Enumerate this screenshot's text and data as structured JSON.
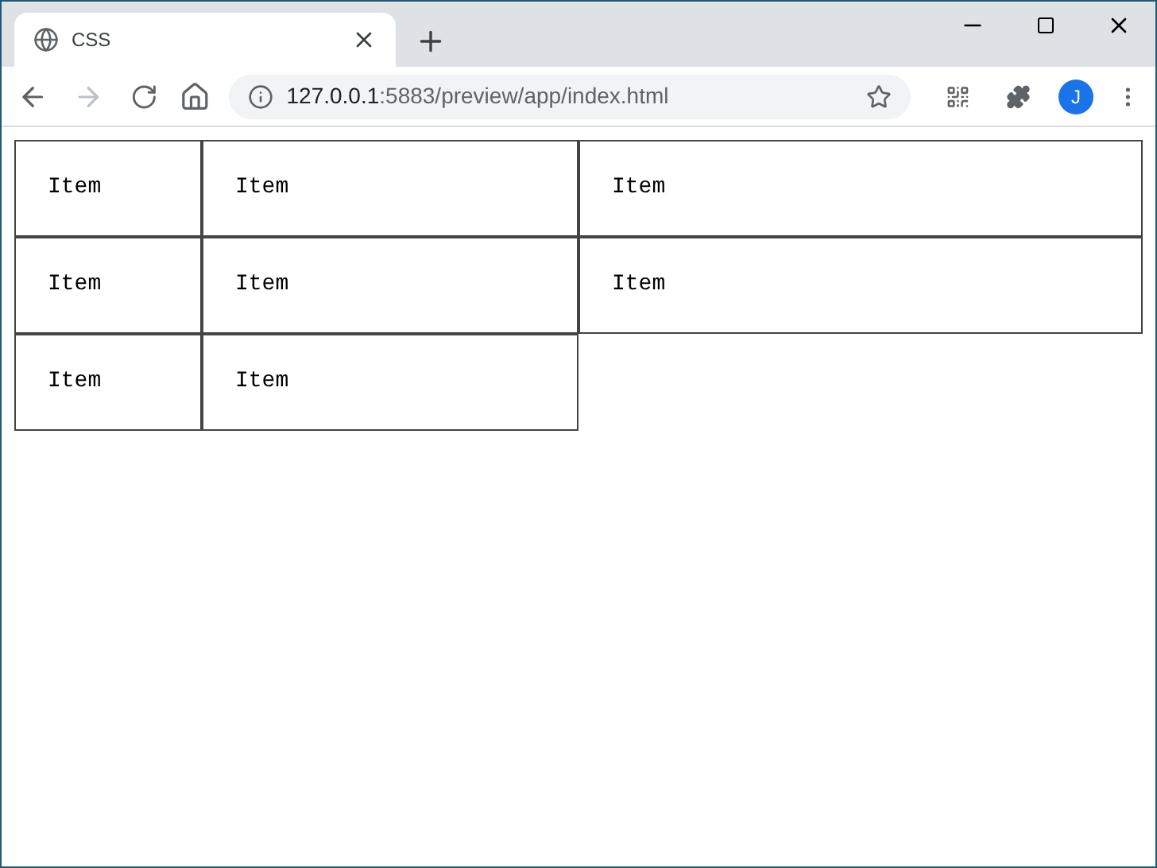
{
  "tab": {
    "title": "CSS"
  },
  "address_bar": {
    "host": "127.0.0.1",
    "path": ":5883/preview/app/index.html"
  },
  "profile": {
    "initial": "J"
  },
  "grid_items": [
    {
      "label": "Item"
    },
    {
      "label": "Item"
    },
    {
      "label": "Item"
    },
    {
      "label": "Item"
    },
    {
      "label": "Item"
    },
    {
      "label": "Item"
    },
    {
      "label": "Item"
    },
    {
      "label": "Item"
    }
  ]
}
